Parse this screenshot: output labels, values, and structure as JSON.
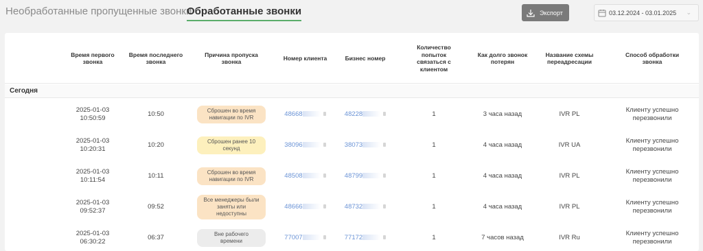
{
  "tabs": [
    {
      "label": "Необработанные пропущенные звонки"
    },
    {
      "label": "Обработанные звонки"
    }
  ],
  "toolbar": {
    "export_label": "Экспорт",
    "date_range": "03.12.2024  -  03.01.2025"
  },
  "table": {
    "columns": [
      "Время первого звонка",
      "Время последнего звонка",
      "Причина пропуска звонка",
      "Номер клиента",
      "Бизнес номер",
      "Количество попыток связаться с клиентом",
      "Как долго звонок потерян",
      "Название схемы переадресации",
      "Способ обработки звонка"
    ],
    "group_label": "Сегодня",
    "rows": [
      {
        "first_date": "2025-01-03",
        "first_time": "10:50:59",
        "last": "10:50",
        "reason": "Сброшен во время навигации по IVR",
        "reason_color": "#fbe3c4",
        "client": "48668",
        "business": "48228",
        "attempts": "1",
        "lost": "3 часа назад",
        "scheme": "IVR PL",
        "method": "Клиенту успешно перезвонили"
      },
      {
        "first_date": "2025-01-03",
        "first_time": "10:20:31",
        "last": "10:20",
        "reason": "Сброшен ранее 10 секунд",
        "reason_color": "#fdf0bd",
        "client": "38096",
        "business": "38073",
        "attempts": "1",
        "lost": "4 часа назад",
        "scheme": "IVR UA",
        "method": "Клиенту успешно перезвонили"
      },
      {
        "first_date": "2025-01-03",
        "first_time": "10:11:54",
        "last": "10:11",
        "reason": "Сброшен во время навигации по IVR",
        "reason_color": "#fbe3c4",
        "client": "48508",
        "business": "48799",
        "attempts": "1",
        "lost": "4 часа назад",
        "scheme": "IVR PL",
        "method": "Клиенту успешно перезвонили"
      },
      {
        "first_date": "2025-01-03",
        "first_time": "09:52:37",
        "last": "09:52",
        "reason": "Все менеджеры были заняты или недоступны",
        "reason_color": "#fbe3c4",
        "client": "48666",
        "business": "48732",
        "attempts": "1",
        "lost": "4 часа назад",
        "scheme": "IVR PL",
        "method": "Клиенту успешно перезвонили"
      },
      {
        "first_date": "2025-01-03",
        "first_time": "06:30:22",
        "last": "06:37",
        "reason": "Вне рабочего времени",
        "reason_color": "#ececec",
        "client": "77007",
        "business": "77172",
        "attempts": "1",
        "lost": "7 часов назад",
        "scheme": "IVR Ru",
        "method": "Клиенту успешно перезвонили"
      }
    ]
  }
}
